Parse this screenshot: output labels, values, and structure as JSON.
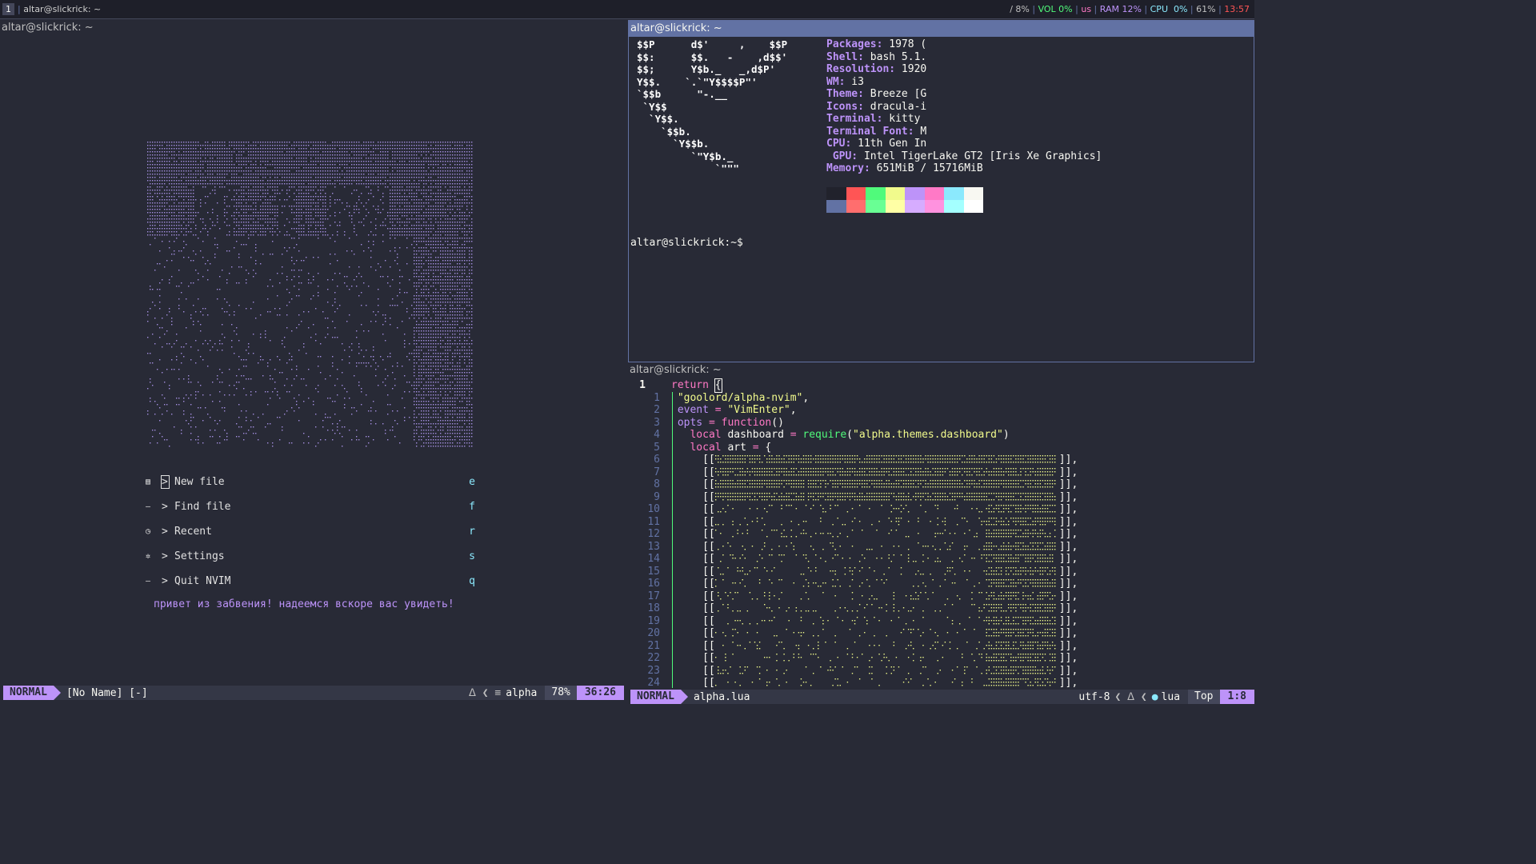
{
  "bar": {
    "workspace": "1",
    "window_title": "altar@slickrick: ~",
    "status": [
      {
        "text": "/ 8%",
        "color": "#c0c0c0"
      },
      {
        "text": " | ",
        "color": "#6272a4"
      },
      {
        "text": "VOL 0%",
        "color": "#50fa7b"
      },
      {
        "text": " | ",
        "color": "#6272a4"
      },
      {
        "text": "us",
        "color": "#ff79c6"
      },
      {
        "text": " | ",
        "color": "#6272a4"
      },
      {
        "text": "RAM 12%",
        "color": "#bd93f9"
      },
      {
        "text": " | ",
        "color": "#6272a4"
      },
      {
        "text": "CPU  0%",
        "color": "#8be9fd"
      },
      {
        "text": " | ",
        "color": "#6272a4"
      },
      {
        "text": "61%",
        "color": "#c0c0c0"
      },
      {
        "text": " | ",
        "color": "#6272a4"
      },
      {
        "text": "13:57",
        "color": "#ff5555"
      }
    ]
  },
  "left": {
    "title": "altar@slickrick: ~",
    "menu": [
      {
        "icon": "file-icon",
        "glyph": "▤",
        "label": "New file",
        "key": "e"
      },
      {
        "icon": "search-icon",
        "glyph": "—",
        "label": "Find file",
        "key": "f"
      },
      {
        "icon": "recent-icon",
        "glyph": "◷",
        "label": "Recent",
        "key": "r"
      },
      {
        "icon": "gear-icon",
        "glyph": "✲",
        "label": "Settings",
        "key": "s"
      },
      {
        "icon": "quit-icon",
        "glyph": "—",
        "label": "Quit NVIM",
        "key": "q"
      }
    ],
    "greeting": "привет из забвения! надеемся вскоре вас увидеть!",
    "statusline": {
      "mode": "NORMAL",
      "file": "[No Name] [-]",
      "filetype": "alpha",
      "percent": "78%",
      "position": "36:26"
    }
  },
  "fetch": {
    "title": "altar@slickrick: ~",
    "logo": [
      "$$P      d$'     ,    $$P",
      "$$:      $$.   -    ,d$$'",
      "$$;      Y$b._   _,d$P'",
      "Y$$.    `.`\"Y$$$$P\"'",
      "`$$b      \"-.__",
      " `Y$$",
      "  `Y$$.",
      "    `$$b.",
      "      `Y$$b.",
      "         `\"Y$b._",
      "             `\"\"\""
    ],
    "info": [
      {
        "k": "Packages",
        "v": " 1978 ("
      },
      {
        "k": "Shell",
        "v": " bash 5.1."
      },
      {
        "k": "Resolution",
        "v": " 1920"
      },
      {
        "k": "WM",
        "v": " i3"
      },
      {
        "k": "Theme",
        "v": " Breeze [G"
      },
      {
        "k": "Icons",
        "v": " dracula-i"
      },
      {
        "k": "Terminal",
        "v": " kitty"
      },
      {
        "k": "Terminal Font",
        "v": " M"
      },
      {
        "k": "CPU",
        "v": " 11th Gen In"
      },
      {
        "k": " GPU",
        "v": " Intel TigerLake GT2 [Iris Xe Graphics]"
      },
      {
        "k": "Memory",
        "v": " 651MiB / 15716MiB"
      }
    ],
    "palette_top": [
      "#21222c",
      "#ff5555",
      "#50fa7b",
      "#f1fa8c",
      "#bd93f9",
      "#ff79c6",
      "#8be9fd",
      "#f8f8f2"
    ],
    "palette_bottom": [
      "#6272a4",
      "#ff6e6e",
      "#69ff94",
      "#ffffa5",
      "#d6acff",
      "#ff92df",
      "#a4ffff",
      "#ffffff"
    ],
    "prompt": "altar@slickrick:~$"
  },
  "editor": {
    "title": "altar@slickrick: ~",
    "cursor_line": "1",
    "lines": [
      {
        "n": "1",
        "segs": [
          {
            "c": "str",
            "t": "\"goolord/alpha-nvim\""
          },
          {
            "c": "txt",
            "t": ","
          }
        ]
      },
      {
        "n": "2",
        "segs": [
          {
            "c": "var",
            "t": "event"
          },
          {
            "c": "op",
            "t": " = "
          },
          {
            "c": "str",
            "t": "\"VimEnter\""
          },
          {
            "c": "txt",
            "t": ","
          }
        ]
      },
      {
        "n": "3",
        "segs": [
          {
            "c": "var",
            "t": "opts"
          },
          {
            "c": "op",
            "t": " = "
          },
          {
            "c": "kw",
            "t": "function"
          },
          {
            "c": "txt",
            "t": "()"
          }
        ]
      },
      {
        "n": "4",
        "segs": [
          {
            "c": "kw",
            "t": "  local"
          },
          {
            "c": "txt",
            "t": " dashboard "
          },
          {
            "c": "op",
            "t": "="
          },
          {
            "c": "fn",
            "t": " require"
          },
          {
            "c": "txt",
            "t": "("
          },
          {
            "c": "str",
            "t": "\"alpha.themes.dashboard\""
          },
          {
            "c": "txt",
            "t": ")"
          }
        ]
      },
      {
        "n": "5",
        "segs": [
          {
            "c": "kw",
            "t": "  local"
          },
          {
            "c": "txt",
            "t": " art "
          },
          {
            "c": "op",
            "t": "="
          },
          {
            "c": "txt",
            "t": " {"
          }
        ]
      }
    ],
    "art_line_numbers": [
      "6",
      "7",
      "8",
      "9",
      "10",
      "11",
      "12",
      "13",
      "14",
      "15",
      "16",
      "17",
      "18",
      "19",
      "20",
      "21",
      "22",
      "23",
      "24"
    ],
    "statusline": {
      "mode": "NORMAL",
      "file": "alpha.lua",
      "encoding": "utf-8",
      "filetype": "lua",
      "scroll": "Top",
      "position": "1:8"
    }
  }
}
